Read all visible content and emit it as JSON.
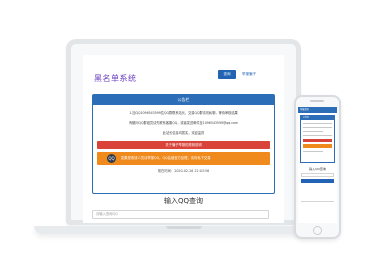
{
  "site": {
    "title": "黑名单系统"
  },
  "nav": {
    "query_label": "查询",
    "report_label": "举报骗子"
  },
  "notice": {
    "header": "公告栏",
    "lines": [
      "1.加QQ1096543599拉QQ群联系站长，交易QQ群请勿私聊，等待审核结果",
      "有疑问QQ群组员请先联系客服QQ，或者发送邮件至1096543599@qq.com",
      "此站长信息均属实，欢迎监督"
    ],
    "red_banner": "关于骗子举报的规则说明",
    "orange_banner": "如果是收钱人员请举报QQ，QQ会被官方处理，请勿私下交易",
    "qq_badge": "QQ",
    "timestamp": "现在时间：2020-02-26 22:03:56"
  },
  "query": {
    "title": "输入QQ查询",
    "placeholder": "请输入查询QQ"
  },
  "phone": {
    "header": "举报查询",
    "card_title": "公告栏",
    "query_title": "输入QQ查询"
  }
}
